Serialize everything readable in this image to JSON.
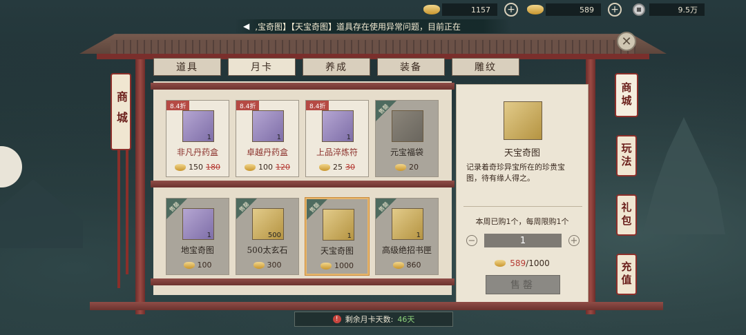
{
  "currency": [
    {
      "icon": "gold-ingot-icon",
      "value": "1157"
    },
    {
      "icon": "silver-ingot-icon",
      "value": "589"
    },
    {
      "icon": "copper-coin-icon",
      "value": "9.5万"
    }
  ],
  "announcement": ",宝奇图】【天宝奇图】道具存在使用异常问题，目前正在",
  "tabs": [
    {
      "label": "道具",
      "active": false
    },
    {
      "label": "月卡",
      "active": true
    },
    {
      "label": "养成",
      "active": false
    },
    {
      "label": "装备",
      "active": false
    },
    {
      "label": "雕纹",
      "active": false
    }
  ],
  "left_scroll": "商城",
  "side_tabs": [
    "商城",
    "玩法",
    "礼包",
    "充值"
  ],
  "items": [
    {
      "name": "非凡丹药盒",
      "badge": "8.4折",
      "price": "150",
      "old_price": "180",
      "qty": "1",
      "state": "available"
    },
    {
      "name": "卓越丹药盒",
      "badge": "8.4折",
      "price": "100",
      "old_price": "120",
      "qty": "1",
      "state": "available"
    },
    {
      "name": "上品淬炼符",
      "badge": "8.4折",
      "price": "25",
      "old_price": "30",
      "qty": "1",
      "state": "available"
    },
    {
      "name": "元宝福袋",
      "badge": "售罄",
      "price": "20",
      "old_price": "",
      "qty": "",
      "state": "soldout"
    },
    {
      "name": "地宝奇图",
      "badge": "售罄",
      "price": "100",
      "old_price": "",
      "qty": "1",
      "state": "soldout"
    },
    {
      "name": "500太玄石",
      "badge": "售罄",
      "price": "300",
      "old_price": "",
      "qty": "500",
      "state": "soldout"
    },
    {
      "name": "天宝奇图",
      "badge": "售罄",
      "price": "1000",
      "old_price": "",
      "qty": "1",
      "state": "selected"
    },
    {
      "name": "高级绝招书匣",
      "badge": "售罄",
      "price": "860",
      "old_price": "",
      "qty": "1",
      "state": "soldout"
    }
  ],
  "detail": {
    "name": "天宝奇图",
    "description": "记录着奇珍异宝所在的珍贵宝图，待有缘人得之。",
    "limit": "本周已购1个，每周限购1个",
    "quantity": "1",
    "owned": "589",
    "cost": "/1000",
    "buy_label": "售罄"
  },
  "footer": {
    "label": "剩余月卡天数:",
    "days": "46天"
  },
  "colors": {
    "accent_red": "#8a2f2a",
    "discount_badge": "#b54a44",
    "soldout_badge": "#4e6b5f",
    "days_green": "#8fd57c"
  }
}
